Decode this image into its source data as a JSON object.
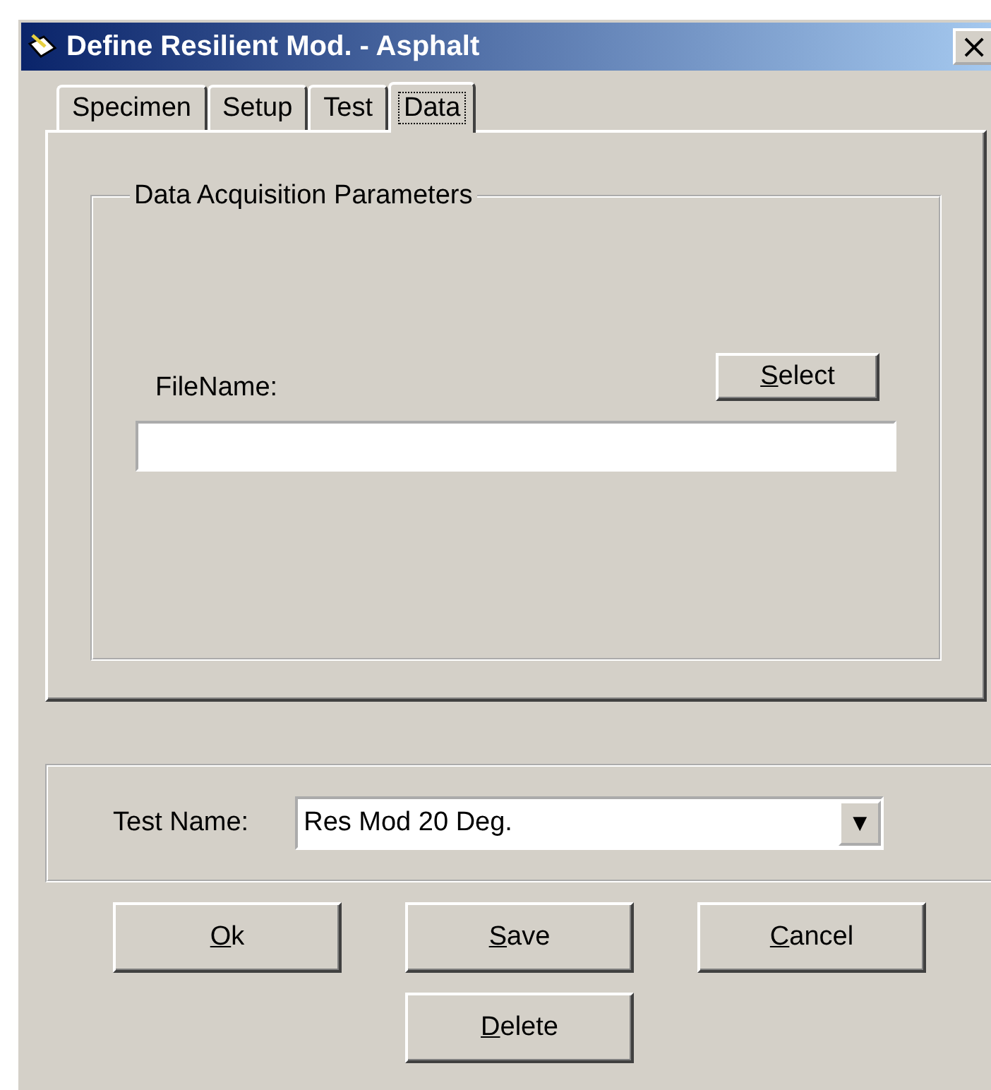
{
  "window": {
    "title": "Define Resilient Mod. - Asphalt",
    "close": "×"
  },
  "tabs": [
    {
      "label": "Specimen",
      "selected": false
    },
    {
      "label": "Setup",
      "selected": false
    },
    {
      "label": "Test",
      "selected": false
    },
    {
      "label": "Data",
      "selected": true
    }
  ],
  "group": {
    "title": "Data Acquisition Parameters",
    "select_button": {
      "access": "S",
      "rest": "elect"
    },
    "file_label": "FileName:"
  },
  "test_name": {
    "label": "Test Name:",
    "value": "Res Mod 20 Deg.",
    "arrow": "▼"
  },
  "buttons": [
    {
      "access": "O",
      "rest": "k"
    },
    {
      "access": "S",
      "rest": "ave"
    },
    {
      "access": "C",
      "rest": "ancel"
    },
    {
      "access": "D",
      "rest": "elete"
    }
  ]
}
